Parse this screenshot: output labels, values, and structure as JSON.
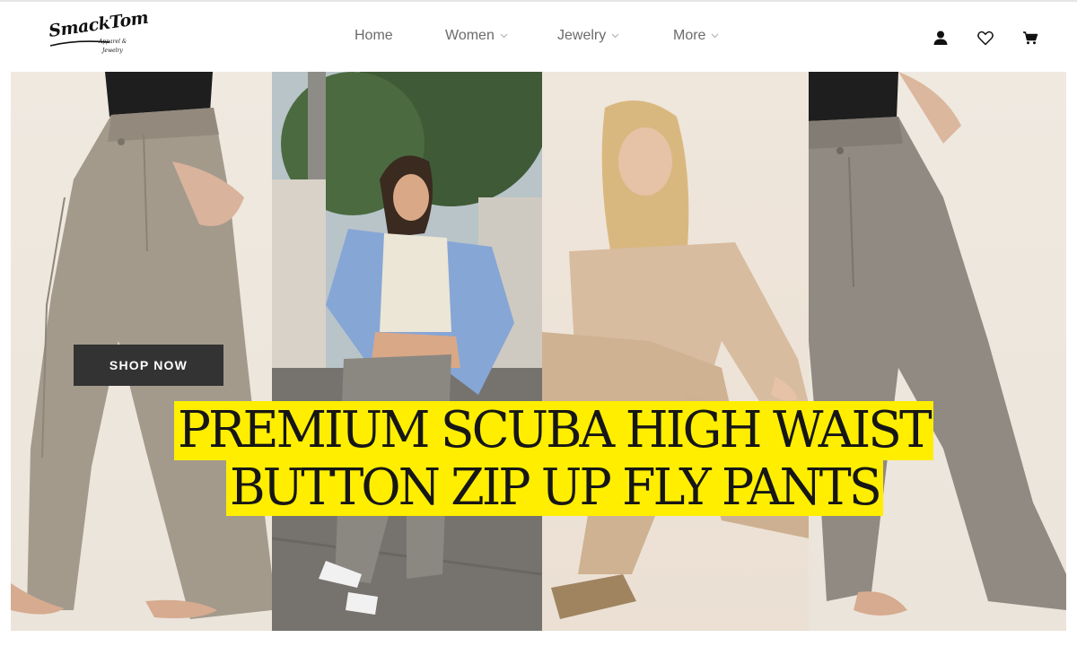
{
  "brand": {
    "name": "SmackTom",
    "tagline_line1": "Apparel &",
    "tagline_line2": "Jewelry"
  },
  "nav": {
    "items": [
      {
        "label": "Home",
        "has_dropdown": false
      },
      {
        "label": "Women",
        "has_dropdown": true
      },
      {
        "label": "Jewelry",
        "has_dropdown": true
      },
      {
        "label": "More",
        "has_dropdown": true
      }
    ]
  },
  "header_icons": [
    "account-icon",
    "wishlist-heart-icon",
    "cart-icon"
  ],
  "hero": {
    "cta_label": "SHOP NOW",
    "headline_line1": "PREMIUM SCUBA HIGH WAIST",
    "headline_line2": "BUTTON ZIP UP FLY PANTS",
    "headline_bg": "#ffee00",
    "cta_bg": "#333333"
  }
}
